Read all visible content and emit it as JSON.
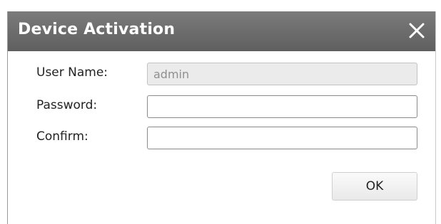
{
  "dialog": {
    "title": "Device Activation",
    "close_icon": "close-icon",
    "fields": {
      "username": {
        "label": "User Name:",
        "value": "admin",
        "placeholder": ""
      },
      "password": {
        "label": "Password:",
        "value": "",
        "placeholder": ""
      },
      "confirm": {
        "label": "Confirm:",
        "value": "",
        "placeholder": ""
      }
    },
    "ok_label": "OK"
  },
  "colors": {
    "titlebar": "#6b6b6b",
    "title_text": "#ffffff",
    "disabled_field_bg": "#ebebeb"
  }
}
